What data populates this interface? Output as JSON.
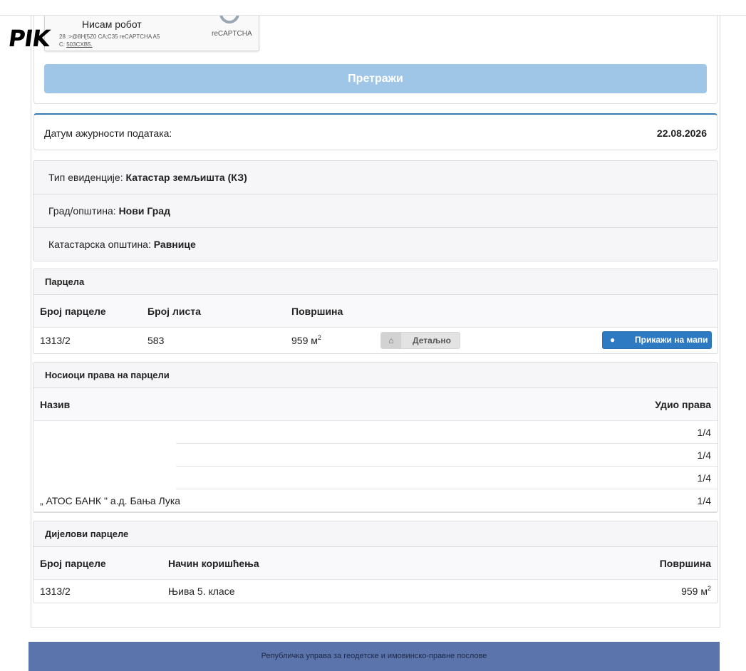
{
  "logo": {
    "text": "PIK"
  },
  "captcha": {
    "label": "Нисам робот",
    "brand": "reCAPTCHA",
    "fine_line1": "28 :>@8H[5Z0 CA;C35 reCAPTCHA A5",
    "fine_line2_prefix": "C: ",
    "fine_line2_link": "503CXB5."
  },
  "search": {
    "button_label": "Претражи"
  },
  "currency": {
    "label": "Датум ажурности података:",
    "value": "22.08.2026"
  },
  "info": [
    {
      "label": "Тип евиденције: ",
      "value": "Катастар земљишта (КЗ)"
    },
    {
      "label": "Град/општина: ",
      "value": "Нови Град"
    },
    {
      "label": "Катастарска општина: ",
      "value": "Равнице"
    }
  ],
  "parcel": {
    "title": "Парцела",
    "headers": {
      "number": "Број парцеле",
      "sheet": "Број листа",
      "area": "Површина"
    },
    "row": {
      "number": "1313/2",
      "sheet": "583",
      "area": "959 м",
      "area_sup": "2"
    },
    "detail_label": "Детаљно",
    "map_label": "Прикажи на мапи"
  },
  "owners": {
    "title": "Носиоци права на парцели",
    "headers": {
      "name": "Назив",
      "share": "Удио права"
    },
    "rows": [
      {
        "name": "",
        "share": "1/4"
      },
      {
        "name": "",
        "share": "1/4"
      },
      {
        "name": "",
        "share": "1/4"
      },
      {
        "name": "„ АТОС БАНК \" а.д. Бања Лука",
        "share": "1/4"
      }
    ]
  },
  "parts": {
    "title": "Дијелови парцеле",
    "headers": {
      "number": "Број парцеле",
      "usage": "Начин коришћења",
      "area": "Површина"
    },
    "row": {
      "number": "1313/2",
      "usage": "Њива 5. класе",
      "area": "959 м",
      "area_sup": "2"
    }
  },
  "footer": {
    "text": "Републичка управа за геодетске и имовинско-правне послове"
  }
}
